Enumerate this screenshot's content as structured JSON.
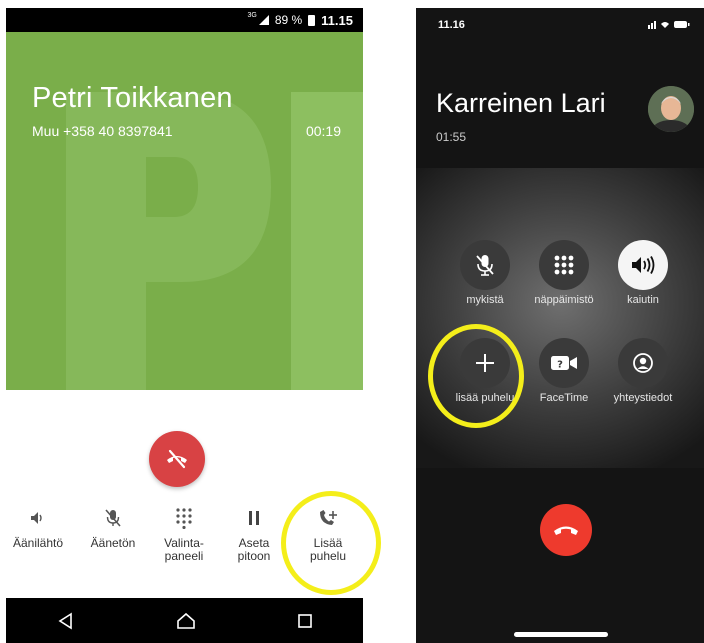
{
  "android": {
    "status": {
      "network": "3G",
      "battery": "89 %",
      "time": "11.15"
    },
    "contact_name": "Petri Toikkanen",
    "contact_number": "Muu +358 40 8397841",
    "call_duration": "00:19",
    "buttons": [
      {
        "label": "Äänilähtö",
        "icon": "speaker-icon"
      },
      {
        "label": "Äänetön",
        "icon": "mute-mic-icon"
      },
      {
        "label": "Valinta-\npaneeli",
        "icon": "dialpad-icon"
      },
      {
        "label": "Aseta\npitoon",
        "icon": "pause-icon"
      },
      {
        "label": "Lisää\npuhelu",
        "icon": "add-call-icon"
      }
    ],
    "header_color": "#7aae4a",
    "end_call_color": "#d84244"
  },
  "iphone": {
    "status": {
      "time": "11.16"
    },
    "contact_name": "Karreinen Lari",
    "call_duration": "01:55",
    "buttons": [
      {
        "label": "mykistä",
        "icon": "mute-mic-icon"
      },
      {
        "label": "näppäimistö",
        "icon": "keypad-icon"
      },
      {
        "label": "kaiutin",
        "icon": "speaker-icon"
      },
      {
        "label": "lisää puhelu",
        "icon": "plus-icon"
      },
      {
        "label": "FaceTime",
        "icon": "facetime-icon"
      },
      {
        "label": "yhteystiedot",
        "icon": "contact-icon"
      }
    ],
    "end_call_color": "#ee3a2d"
  },
  "highlight_color": "#f4ee1a"
}
